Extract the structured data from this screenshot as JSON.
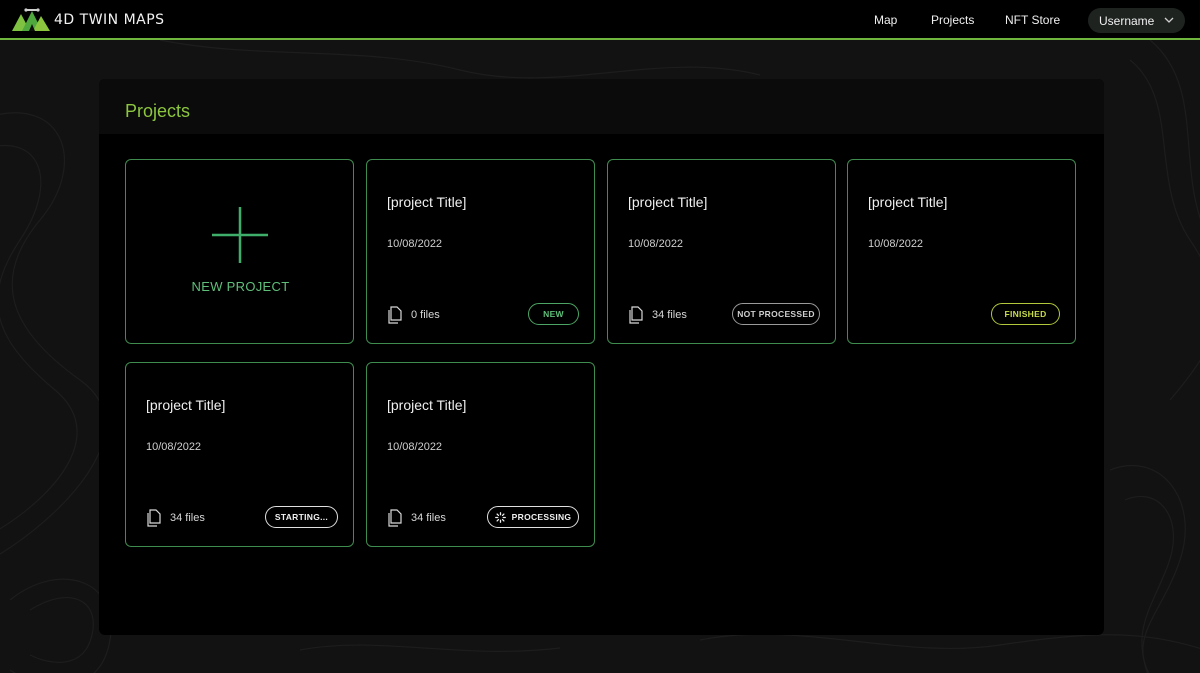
{
  "app": {
    "brand": "4D TWIN MAPS"
  },
  "nav": {
    "map": "Map",
    "projects": "Projects",
    "nft_store": "NFT Store",
    "username": "Username"
  },
  "panel": {
    "title": "Projects"
  },
  "new_project": {
    "label": "NEW PROJECT"
  },
  "projects": [
    {
      "title": "[project Title]",
      "date": "10/08/2022",
      "files": "0 files",
      "status": "NEW"
    },
    {
      "title": "[project Title]",
      "date": "10/08/2022",
      "files": "34 files",
      "status": "NOT PROCESSED"
    },
    {
      "title": "[project Title]",
      "date": "10/08/2022",
      "files": "",
      "status": "FINISHED"
    },
    {
      "title": "[project Title]",
      "date": "10/08/2022",
      "files": "34 files",
      "status": "STARTING..."
    },
    {
      "title": "[project Title]",
      "date": "10/08/2022",
      "files": "34 files",
      "status": "PROCESSING"
    }
  ],
  "colors": {
    "accent": "#6fb63c",
    "title_green": "#8cc63f",
    "card_border": "#3f8c4f",
    "new_badge": "#5fbf7a",
    "finished_badge": "#c9dc4a"
  },
  "icons": {
    "logo": "mountain-drone-logo",
    "chevron": "chevron-down-icon",
    "plus": "plus-icon",
    "file": "file-icon",
    "spinner": "spinner-icon"
  }
}
